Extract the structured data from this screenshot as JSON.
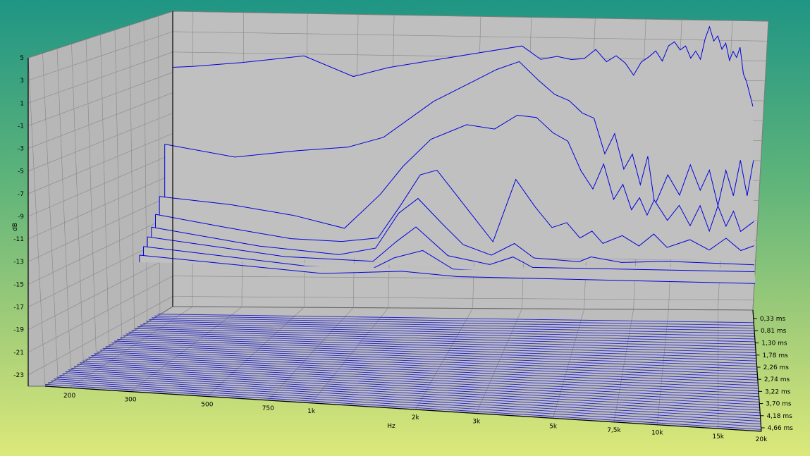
{
  "chart_data": {
    "type": "waterfall-3d",
    "title": "",
    "xlabel": "Hz",
    "ylabel": "dB",
    "zlabel": "",
    "x_scale": "log",
    "xlim": [
      170,
      20000
    ],
    "ylim": [
      -24,
      5
    ],
    "x_ticks": [
      200,
      300,
      500,
      750,
      1000,
      2000,
      3000,
      5000,
      7500,
      10000,
      15000,
      20000
    ],
    "x_tick_labels": [
      "200",
      "300",
      "500",
      "750",
      "1k",
      "2k",
      "3k",
      "5k",
      "7,5k",
      "10k",
      "15k",
      "20k"
    ],
    "y_ticks": [
      5,
      3,
      1,
      -1,
      -3,
      -5,
      -7,
      -9,
      -11,
      -13,
      -15,
      -17,
      -19,
      -21,
      -23
    ],
    "y_tick_labels": [
      "5",
      "3",
      "1",
      "-1",
      "-3",
      "-5",
      "-7",
      "-9",
      "-11",
      "-13",
      "-15",
      "-17",
      "-19",
      "-21",
      "-23"
    ],
    "z_ticks": [
      0.33,
      0.81,
      1.3,
      1.78,
      2.26,
      2.74,
      3.22,
      3.7,
      4.18,
      4.66
    ],
    "z_tick_labels": [
      "0,33 ms",
      "0,81 ms",
      "1,30 ms",
      "1,78 ms",
      "2,26 ms",
      "2,74 ms",
      "3,22 ms",
      "3,70 ms",
      "4,18 ms",
      "4,66 ms"
    ],
    "zlim": [
      0,
      4.8
    ],
    "grid": true,
    "colors": {
      "line": "#0000dd",
      "fill": "#c0c0c0",
      "wall": "#bfbfbf",
      "grid": "#888888",
      "floor_line": "#2222cc"
    },
    "series": [
      {
        "t": 0.0,
        "points": [
          [
            170,
            -0.5
          ],
          [
            200,
            -0.4
          ],
          [
            300,
            0.0
          ],
          [
            500,
            0.7
          ],
          [
            750,
            -1.3
          ],
          [
            1000,
            -0.4
          ],
          [
            2000,
            1.0
          ],
          [
            3000,
            1.8
          ],
          [
            3500,
            0.5
          ],
          [
            4000,
            0.8
          ],
          [
            4500,
            0.5
          ],
          [
            5000,
            0.6
          ],
          [
            5500,
            1.5
          ],
          [
            6000,
            0.3
          ],
          [
            6500,
            0.9
          ],
          [
            7000,
            0.2
          ],
          [
            7500,
            -1.0
          ],
          [
            8000,
            0.3
          ],
          [
            8500,
            0.8
          ],
          [
            9000,
            1.4
          ],
          [
            9500,
            0.4
          ],
          [
            10000,
            1.9
          ],
          [
            10500,
            2.3
          ],
          [
            11000,
            1.5
          ],
          [
            11500,
            1.9
          ],
          [
            12000,
            0.7
          ],
          [
            12500,
            1.4
          ],
          [
            13000,
            0.6
          ],
          [
            13500,
            2.6
          ],
          [
            14000,
            3.8
          ],
          [
            14500,
            2.4
          ],
          [
            15000,
            2.9
          ],
          [
            15500,
            1.6
          ],
          [
            16000,
            2.2
          ],
          [
            16500,
            0.5
          ],
          [
            17000,
            1.4
          ],
          [
            17500,
            0.8
          ],
          [
            18000,
            1.8
          ],
          [
            18500,
            -0.8
          ],
          [
            19000,
            -1.6
          ],
          [
            19500,
            -2.8
          ],
          [
            20000,
            -4.0
          ]
        ]
      },
      {
        "t": 0.3,
        "points": [
          [
            170,
            -7.5
          ],
          [
            300,
            -8.7
          ],
          [
            500,
            -8.0
          ],
          [
            750,
            -7.6
          ],
          [
            1000,
            -6.6
          ],
          [
            1500,
            -3.0
          ],
          [
            2000,
            -1.2
          ],
          [
            2500,
            0.2
          ],
          [
            3000,
            1.0
          ],
          [
            3500,
            -0.8
          ],
          [
            4000,
            -2.2
          ],
          [
            4500,
            -2.8
          ],
          [
            5000,
            -4.0
          ],
          [
            5500,
            -4.5
          ],
          [
            6000,
            -8.0
          ],
          [
            6500,
            -6.0
          ],
          [
            7000,
            -9.5
          ],
          [
            7500,
            -8.0
          ],
          [
            8000,
            -11.0
          ],
          [
            8500,
            -8.2
          ],
          [
            9000,
            -13.0
          ],
          [
            10000,
            -10.0
          ],
          [
            11000,
            -12.0
          ],
          [
            12000,
            -9.0
          ],
          [
            13000,
            -11.5
          ],
          [
            14000,
            -9.5
          ],
          [
            15000,
            -13.0
          ],
          [
            16000,
            -9.5
          ],
          [
            17000,
            -12.0
          ],
          [
            18000,
            -8.5
          ],
          [
            19000,
            -12.0
          ],
          [
            20000,
            -8.5
          ]
        ]
      },
      {
        "t": 0.5,
        "points": [
          [
            170,
            -12.3
          ],
          [
            300,
            -13.0
          ],
          [
            500,
            -14.0
          ],
          [
            750,
            -15.2
          ],
          [
            1000,
            -11.8
          ],
          [
            1200,
            -9.0
          ],
          [
            1500,
            -6.3
          ],
          [
            2000,
            -4.8
          ],
          [
            2500,
            -5.2
          ],
          [
            3000,
            -3.8
          ],
          [
            3500,
            -4.0
          ],
          [
            4000,
            -5.5
          ],
          [
            4500,
            -6.3
          ],
          [
            5000,
            -9.2
          ],
          [
            5500,
            -11.0
          ],
          [
            6000,
            -8.5
          ],
          [
            6500,
            -12.0
          ],
          [
            7000,
            -10.5
          ],
          [
            7500,
            -13.0
          ],
          [
            8000,
            -11.8
          ],
          [
            8500,
            -13.5
          ],
          [
            9000,
            -12.0
          ],
          [
            10000,
            -14.0
          ],
          [
            11000,
            -12.5
          ],
          [
            12000,
            -14.5
          ],
          [
            13000,
            -12.5
          ],
          [
            14000,
            -15.0
          ],
          [
            15000,
            -12.5
          ],
          [
            16000,
            -14.5
          ],
          [
            17000,
            -13.0
          ],
          [
            18000,
            -15.0
          ],
          [
            20000,
            -14.0
          ]
        ]
      },
      {
        "t": 0.65,
        "points": [
          [
            170,
            -13.8
          ],
          [
            300,
            -15.0
          ],
          [
            500,
            -16.0
          ],
          [
            750,
            -16.2
          ],
          [
            1000,
            -15.8
          ],
          [
            1200,
            -12.5
          ],
          [
            1400,
            -9.5
          ],
          [
            1600,
            -9.0
          ],
          [
            2000,
            -12.5
          ],
          [
            2500,
            -16.0
          ],
          [
            3000,
            -9.8
          ],
          [
            3500,
            -12.5
          ],
          [
            4000,
            -14.5
          ],
          [
            4500,
            -14.0
          ],
          [
            5000,
            -15.5
          ],
          [
            5500,
            -14.8
          ],
          [
            6000,
            -16.0
          ],
          [
            7000,
            -15.2
          ],
          [
            8000,
            -16.2
          ],
          [
            9000,
            -15.0
          ],
          [
            10000,
            -16.3
          ],
          [
            12000,
            -15.5
          ],
          [
            14000,
            -16.5
          ],
          [
            16000,
            -15.3
          ],
          [
            18000,
            -16.5
          ],
          [
            20000,
            -16.0
          ]
        ]
      },
      {
        "t": 0.8,
        "points": [
          [
            170,
            -14.8
          ],
          [
            400,
            -16.5
          ],
          [
            750,
            -17.2
          ],
          [
            1000,
            -16.5
          ],
          [
            1200,
            -13.0
          ],
          [
            1400,
            -11.5
          ],
          [
            1700,
            -14.0
          ],
          [
            2000,
            -16.0
          ],
          [
            2500,
            -17.0
          ],
          [
            3000,
            -15.8
          ],
          [
            3500,
            -17.2
          ],
          [
            5000,
            -17.5
          ],
          [
            5500,
            -17.0
          ],
          [
            7000,
            -17.5
          ],
          [
            10000,
            -17.3
          ],
          [
            20000,
            -17.5
          ]
        ]
      },
      {
        "t": 0.95,
        "points": [
          [
            170,
            -15.5
          ],
          [
            500,
            -17.2
          ],
          [
            1000,
            -17.5
          ],
          [
            1200,
            -15.5
          ],
          [
            1400,
            -14.0
          ],
          [
            1800,
            -16.8
          ],
          [
            2500,
            -17.6
          ],
          [
            3000,
            -16.8
          ],
          [
            3500,
            -17.8
          ],
          [
            20000,
            -17.8
          ]
        ]
      },
      {
        "t": 1.1,
        "points": [
          [
            170,
            -16.2
          ],
          [
            600,
            -17.8
          ],
          [
            1000,
            -18.0
          ],
          [
            1200,
            -16.8
          ],
          [
            1500,
            -16.0
          ],
          [
            1900,
            -17.8
          ],
          [
            3000,
            -18.0
          ],
          [
            20000,
            -18.0
          ]
        ]
      },
      {
        "t": 1.25,
        "points": [
          [
            170,
            -16.8
          ],
          [
            700,
            -18.2
          ],
          [
            1300,
            -17.8
          ],
          [
            2000,
            -18.2
          ],
          [
            20000,
            -18.2
          ]
        ]
      }
    ]
  }
}
